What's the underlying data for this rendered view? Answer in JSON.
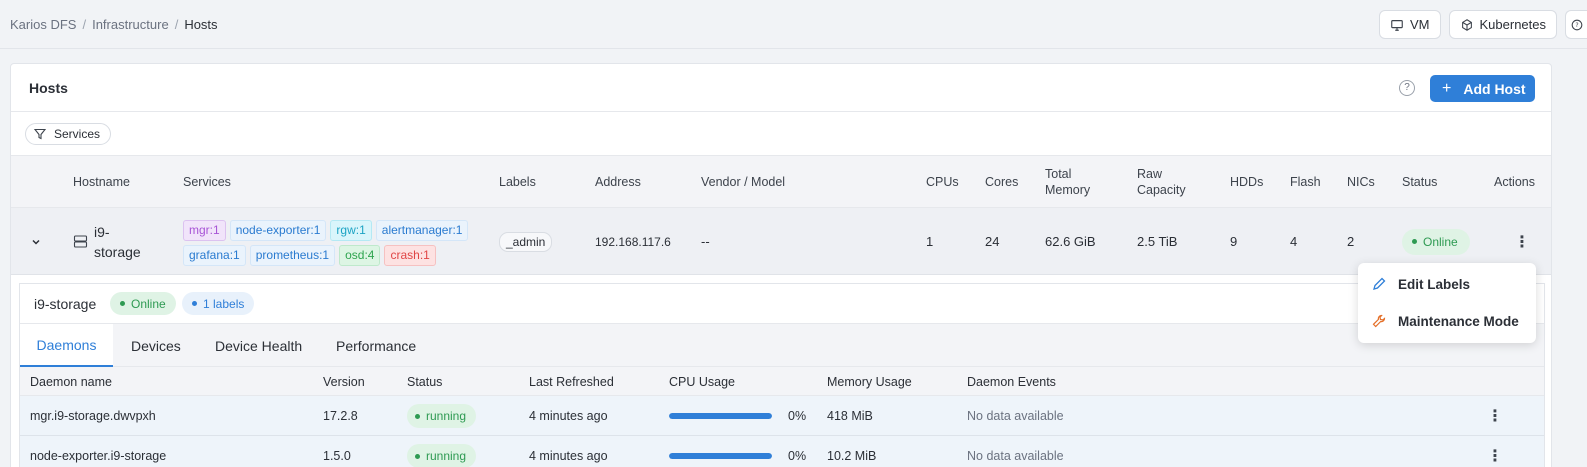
{
  "breadcrumb": [
    "Karios DFS",
    "Infrastructure",
    "Hosts"
  ],
  "top_buttons": {
    "vm": "VM",
    "kubernetes": "Kubernetes",
    "help": "?"
  },
  "panel": {
    "title": "Hosts",
    "help": "?",
    "add_host": "Add Host",
    "add_plus": "+"
  },
  "filter": {
    "label": "Services"
  },
  "host_columns": [
    "Hostname",
    "Services",
    "Labels",
    "Address",
    "Vendor / Model",
    "CPUs",
    "Cores",
    "Total Memory",
    "Raw Capacity",
    "HDDs",
    "Flash",
    "NICs",
    "Status",
    "Actions"
  ],
  "host": {
    "hostname": "i9-storage",
    "services": [
      {
        "label": "mgr:1",
        "color": "purple"
      },
      {
        "label": "node-exporter:1",
        "color": "blue"
      },
      {
        "label": "rgw:1",
        "color": "cyan"
      },
      {
        "label": "alertmanager:1",
        "color": "blue"
      },
      {
        "label": "grafana:1",
        "color": "blue"
      },
      {
        "label": "prometheus:1",
        "color": "blue"
      },
      {
        "label": "osd:4",
        "color": "green"
      },
      {
        "label": "crash:1",
        "color": "red"
      }
    ],
    "labels": "_admin",
    "address": "192.168.117.6",
    "vendor_model": "--",
    "cpus": "1",
    "cores": "24",
    "total_memory": "62.6 GiB",
    "raw_capacity": "2.5 TiB",
    "hdds": "9",
    "flash": "4",
    "nics": "2",
    "status": "Online"
  },
  "detail": {
    "title": "i9-storage",
    "status": "Online",
    "labels_count": "1 labels",
    "tabs": [
      "Daemons",
      "Devices",
      "Device Health",
      "Performance"
    ],
    "active_tab": "Daemons",
    "columns": [
      "Daemon name",
      "Version",
      "Status",
      "Last Refreshed",
      "CPU Usage",
      "Memory Usage",
      "Daemon Events"
    ],
    "rows": [
      {
        "name": "mgr.i9-storage.dwvpxh",
        "version": "17.2.8",
        "status": "running",
        "refreshed": "4 minutes ago",
        "cpu": "0%",
        "cpu_fill": 1.0,
        "memory": "418 MiB",
        "events": "No data available"
      },
      {
        "name": "node-exporter.i9-storage",
        "version": "1.5.0",
        "status": "running",
        "refreshed": "4 minutes ago",
        "cpu": "0%",
        "cpu_fill": 1.0,
        "memory": "10.2 MiB",
        "events": "No data available"
      }
    ]
  },
  "context_menu": {
    "items": [
      {
        "label": "Edit Labels",
        "icon": "pencil-icon",
        "color": "#2f7fd8"
      },
      {
        "label": "Maintenance Mode",
        "icon": "wrench-icon",
        "color": "#e4702a"
      }
    ]
  },
  "colors": {
    "accent": "#2f7fd8",
    "online": "#2e9a52"
  }
}
